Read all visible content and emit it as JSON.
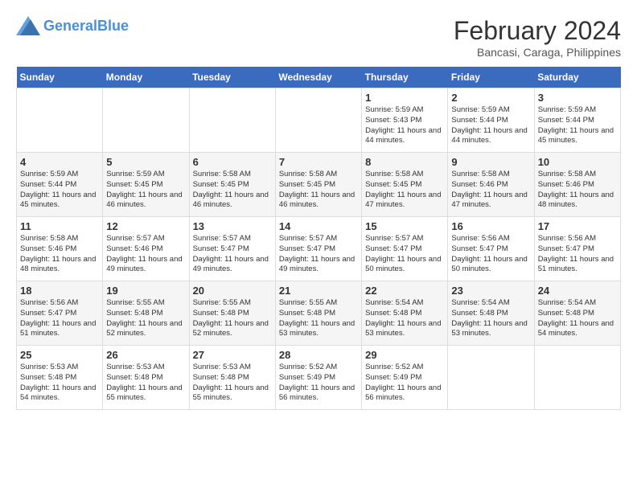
{
  "header": {
    "logo_general": "General",
    "logo_blue": "Blue",
    "month_year": "February 2024",
    "location": "Bancasi, Caraga, Philippines"
  },
  "weekdays": [
    "Sunday",
    "Monday",
    "Tuesday",
    "Wednesday",
    "Thursday",
    "Friday",
    "Saturday"
  ],
  "weeks": [
    [
      {
        "day": "",
        "info": ""
      },
      {
        "day": "",
        "info": ""
      },
      {
        "day": "",
        "info": ""
      },
      {
        "day": "",
        "info": ""
      },
      {
        "day": "1",
        "info": "Sunrise: 5:59 AM\nSunset: 5:43 PM\nDaylight: 11 hours and 44 minutes."
      },
      {
        "day": "2",
        "info": "Sunrise: 5:59 AM\nSunset: 5:44 PM\nDaylight: 11 hours and 44 minutes."
      },
      {
        "day": "3",
        "info": "Sunrise: 5:59 AM\nSunset: 5:44 PM\nDaylight: 11 hours and 45 minutes."
      }
    ],
    [
      {
        "day": "4",
        "info": "Sunrise: 5:59 AM\nSunset: 5:44 PM\nDaylight: 11 hours and 45 minutes."
      },
      {
        "day": "5",
        "info": "Sunrise: 5:59 AM\nSunset: 5:45 PM\nDaylight: 11 hours and 46 minutes."
      },
      {
        "day": "6",
        "info": "Sunrise: 5:58 AM\nSunset: 5:45 PM\nDaylight: 11 hours and 46 minutes."
      },
      {
        "day": "7",
        "info": "Sunrise: 5:58 AM\nSunset: 5:45 PM\nDaylight: 11 hours and 46 minutes."
      },
      {
        "day": "8",
        "info": "Sunrise: 5:58 AM\nSunset: 5:45 PM\nDaylight: 11 hours and 47 minutes."
      },
      {
        "day": "9",
        "info": "Sunrise: 5:58 AM\nSunset: 5:46 PM\nDaylight: 11 hours and 47 minutes."
      },
      {
        "day": "10",
        "info": "Sunrise: 5:58 AM\nSunset: 5:46 PM\nDaylight: 11 hours and 48 minutes."
      }
    ],
    [
      {
        "day": "11",
        "info": "Sunrise: 5:58 AM\nSunset: 5:46 PM\nDaylight: 11 hours and 48 minutes."
      },
      {
        "day": "12",
        "info": "Sunrise: 5:57 AM\nSunset: 5:46 PM\nDaylight: 11 hours and 49 minutes."
      },
      {
        "day": "13",
        "info": "Sunrise: 5:57 AM\nSunset: 5:47 PM\nDaylight: 11 hours and 49 minutes."
      },
      {
        "day": "14",
        "info": "Sunrise: 5:57 AM\nSunset: 5:47 PM\nDaylight: 11 hours and 49 minutes."
      },
      {
        "day": "15",
        "info": "Sunrise: 5:57 AM\nSunset: 5:47 PM\nDaylight: 11 hours and 50 minutes."
      },
      {
        "day": "16",
        "info": "Sunrise: 5:56 AM\nSunset: 5:47 PM\nDaylight: 11 hours and 50 minutes."
      },
      {
        "day": "17",
        "info": "Sunrise: 5:56 AM\nSunset: 5:47 PM\nDaylight: 11 hours and 51 minutes."
      }
    ],
    [
      {
        "day": "18",
        "info": "Sunrise: 5:56 AM\nSunset: 5:47 PM\nDaylight: 11 hours and 51 minutes."
      },
      {
        "day": "19",
        "info": "Sunrise: 5:55 AM\nSunset: 5:48 PM\nDaylight: 11 hours and 52 minutes."
      },
      {
        "day": "20",
        "info": "Sunrise: 5:55 AM\nSunset: 5:48 PM\nDaylight: 11 hours and 52 minutes."
      },
      {
        "day": "21",
        "info": "Sunrise: 5:55 AM\nSunset: 5:48 PM\nDaylight: 11 hours and 53 minutes."
      },
      {
        "day": "22",
        "info": "Sunrise: 5:54 AM\nSunset: 5:48 PM\nDaylight: 11 hours and 53 minutes."
      },
      {
        "day": "23",
        "info": "Sunrise: 5:54 AM\nSunset: 5:48 PM\nDaylight: 11 hours and 53 minutes."
      },
      {
        "day": "24",
        "info": "Sunrise: 5:54 AM\nSunset: 5:48 PM\nDaylight: 11 hours and 54 minutes."
      }
    ],
    [
      {
        "day": "25",
        "info": "Sunrise: 5:53 AM\nSunset: 5:48 PM\nDaylight: 11 hours and 54 minutes."
      },
      {
        "day": "26",
        "info": "Sunrise: 5:53 AM\nSunset: 5:48 PM\nDaylight: 11 hours and 55 minutes."
      },
      {
        "day": "27",
        "info": "Sunrise: 5:53 AM\nSunset: 5:48 PM\nDaylight: 11 hours and 55 minutes."
      },
      {
        "day": "28",
        "info": "Sunrise: 5:52 AM\nSunset: 5:49 PM\nDaylight: 11 hours and 56 minutes."
      },
      {
        "day": "29",
        "info": "Sunrise: 5:52 AM\nSunset: 5:49 PM\nDaylight: 11 hours and 56 minutes."
      },
      {
        "day": "",
        "info": ""
      },
      {
        "day": "",
        "info": ""
      }
    ]
  ]
}
